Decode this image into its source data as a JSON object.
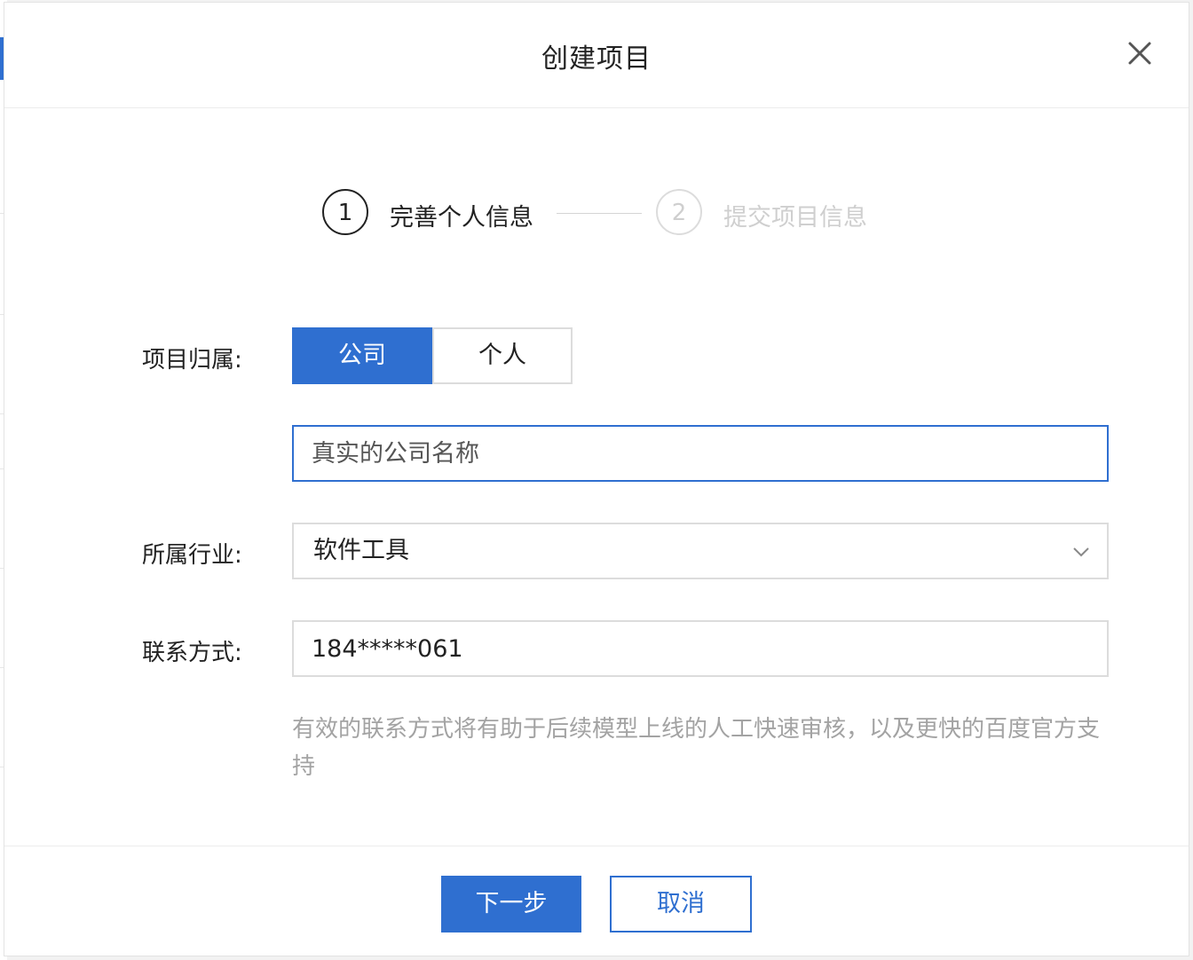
{
  "dialog": {
    "title": "创建项目",
    "close_icon": "close-icon"
  },
  "steps": [
    {
      "number": "1",
      "label": "完善个人信息",
      "state": "active"
    },
    {
      "number": "2",
      "label": "提交项目信息",
      "state": "inactive"
    }
  ],
  "form": {
    "ownership": {
      "label": "项目归属:",
      "options": [
        "公司",
        "个人"
      ],
      "selected": "公司"
    },
    "company_name": {
      "value": "",
      "placeholder": "真实的公司名称"
    },
    "industry": {
      "label": "所属行业:",
      "value": "软件工具",
      "arrow_icon": "chevron-down-icon"
    },
    "contact": {
      "label": "联系方式:",
      "value": "184*****061"
    },
    "hint": "有效的联系方式将有助于后续模型上线的人工快速审核，以及更快的百度官方支持"
  },
  "footer": {
    "next_label": "下一步",
    "cancel_label": "取消"
  },
  "colors": {
    "primary": "#2f6fd0",
    "border": "#dcdcdc",
    "muted_text": "#a3a3a3",
    "inactive_step": "#cfcfcf"
  }
}
